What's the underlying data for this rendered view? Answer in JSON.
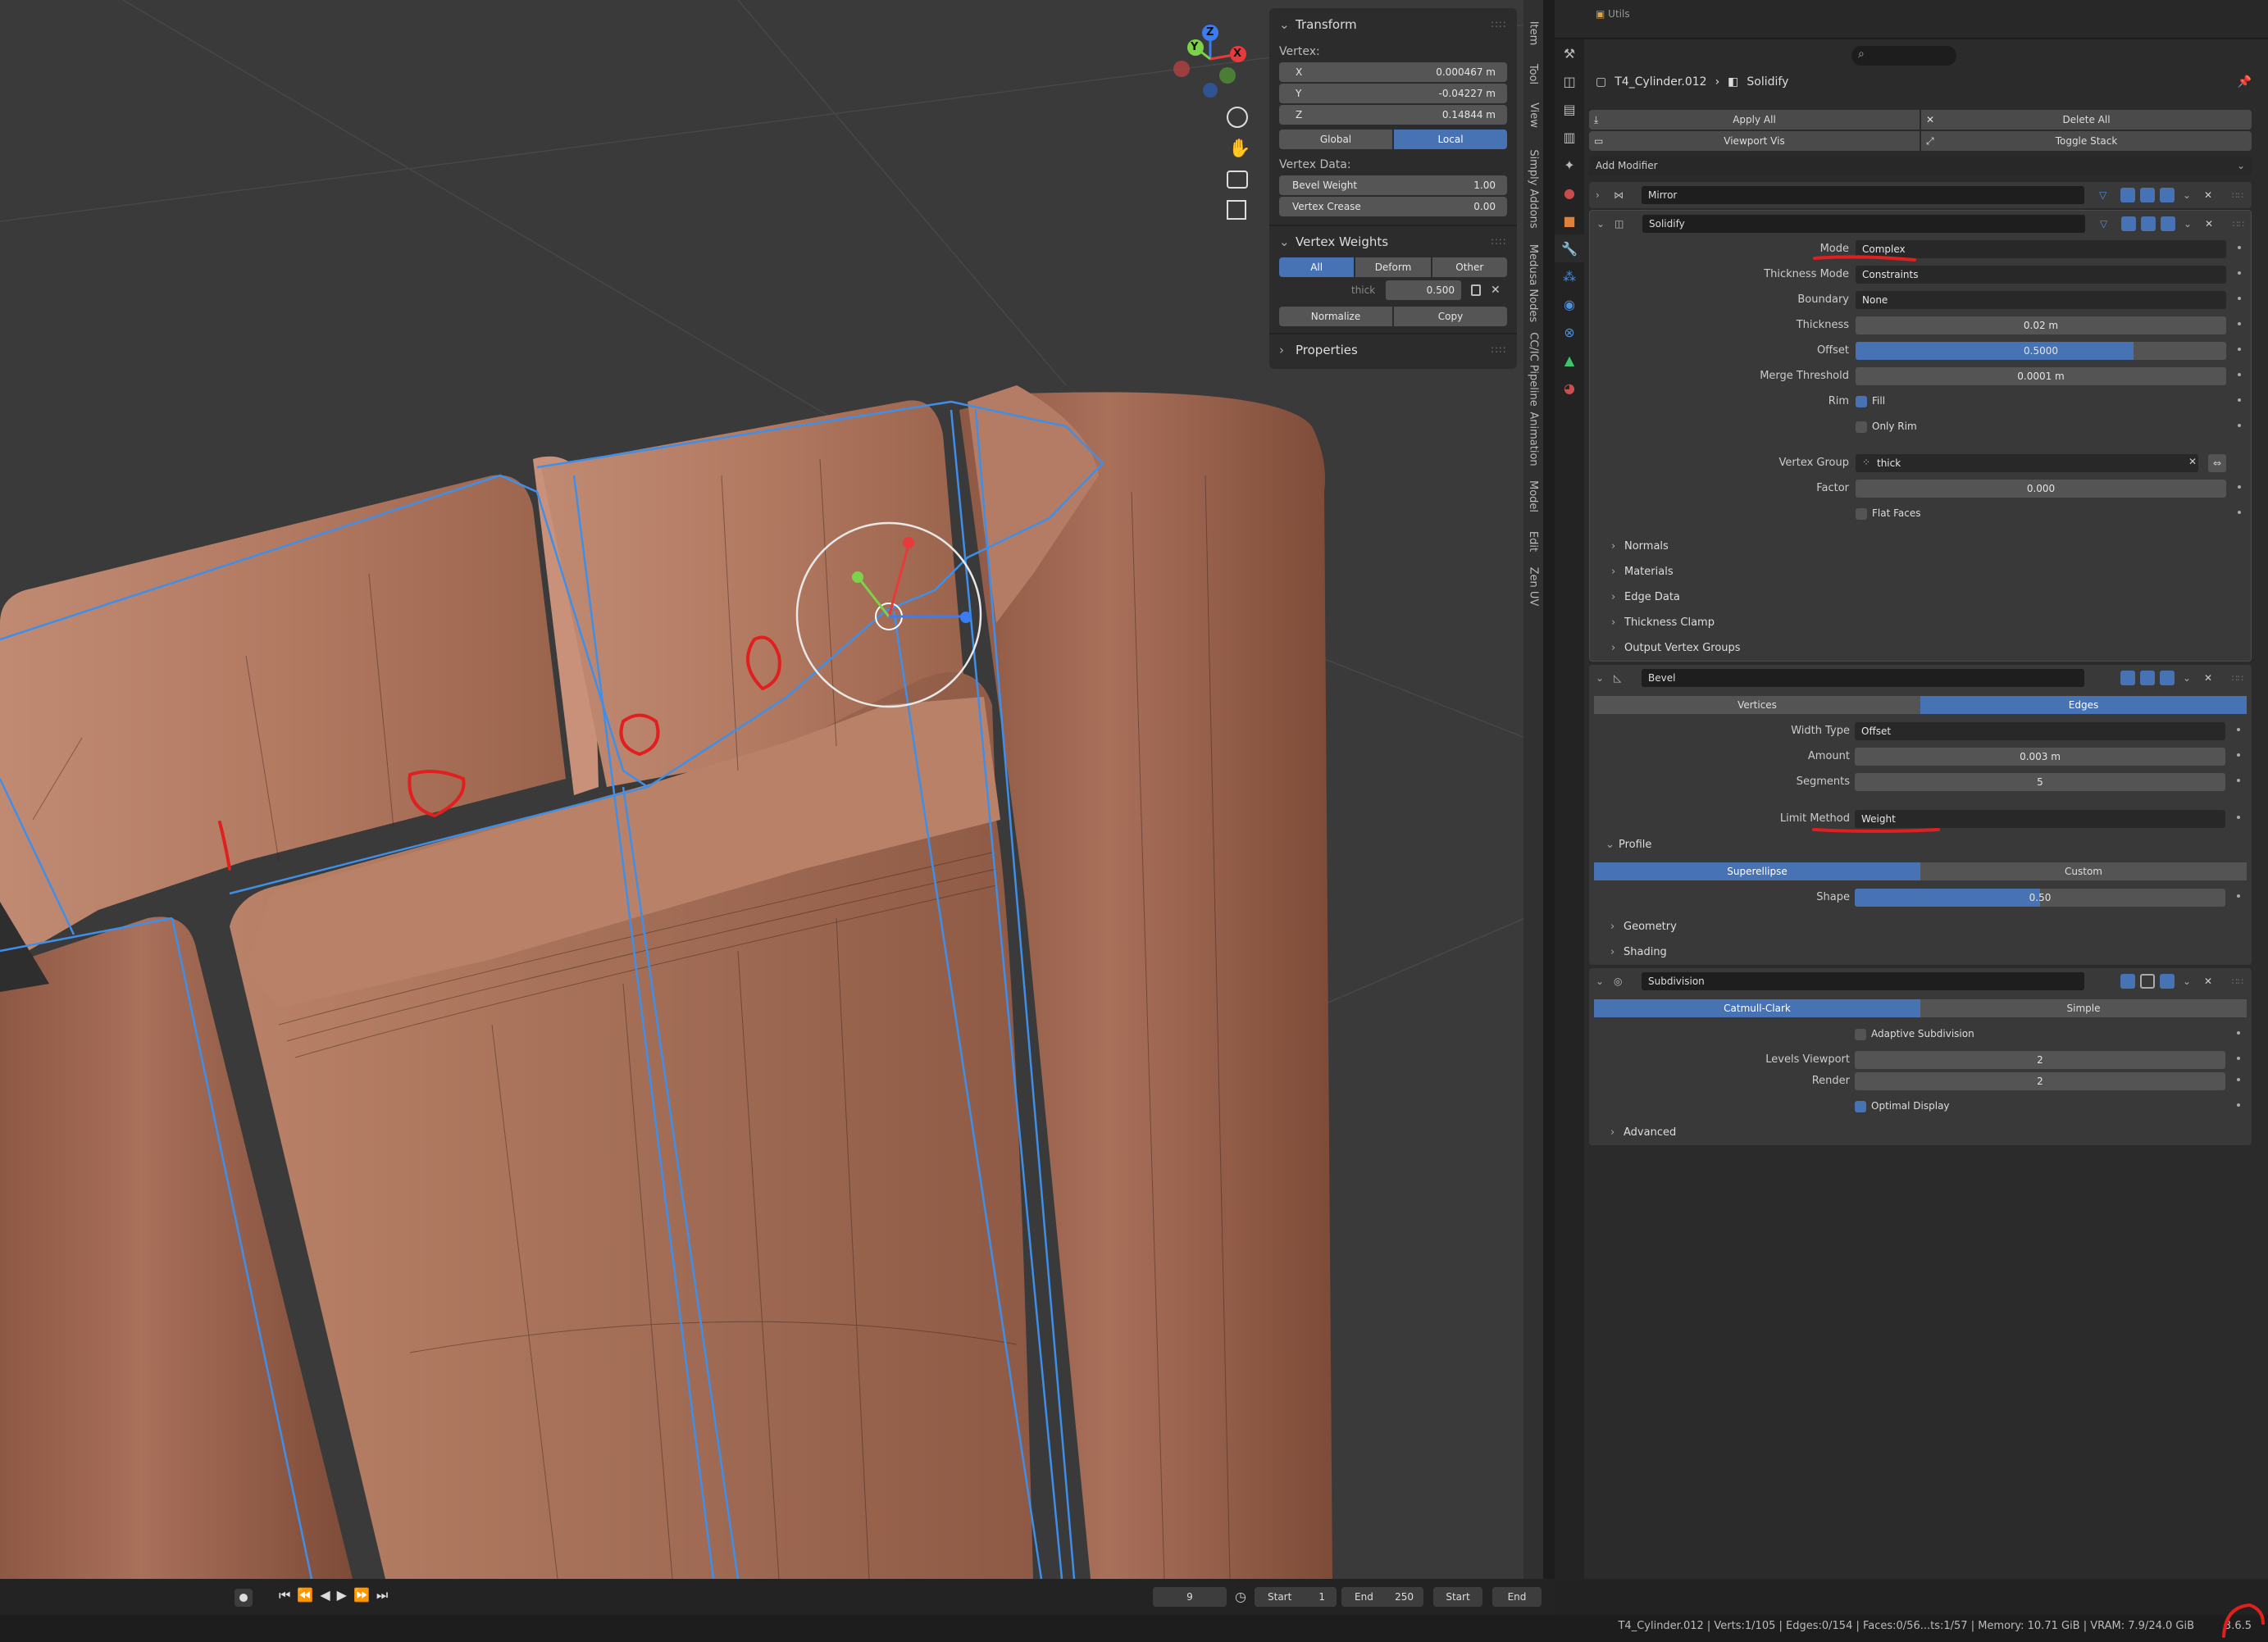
{
  "npanel": {
    "transform_title": "Transform",
    "vertex_label": "Vertex:",
    "x_label": "X",
    "x_value": "0.000467 m",
    "y_label": "Y",
    "y_value": "-0.04227 m",
    "z_label": "Z",
    "z_value": "0.14844 m",
    "global_label": "Global",
    "local_label": "Local",
    "vertex_data_label": "Vertex Data:",
    "bevel_weight_label": "Bevel Weight",
    "bevel_weight_value": "1.00",
    "vertex_crease_label": "Vertex Crease",
    "vertex_crease_value": "0.00",
    "vertex_weights_title": "Vertex Weights",
    "all_label": "All",
    "deform_label": "Deform",
    "other_label": "Other",
    "group_name": "thick",
    "group_weight": "0.500",
    "normalize_label": "Normalize",
    "copy_label": "Copy",
    "properties_title": "Properties"
  },
  "sidebar_tabs": [
    "Item",
    "Tool",
    "View",
    "Simply Addons",
    "Medusa Nodes",
    "CC/IC Pipeline",
    "Animation",
    "Model",
    "Edit",
    "Zen UV"
  ],
  "outliner": {
    "item": "Utils"
  },
  "properties": {
    "object_name": "T4_Cylinder.012",
    "modifier_name": "Solidify",
    "apply_all": "Apply All",
    "delete_all": "Delete All",
    "viewport_vis": "Viewport Vis",
    "toggle_stack": "Toggle Stack",
    "add_modifier": "Add Modifier",
    "mirror": {
      "name": "Mirror"
    },
    "solidify": {
      "name": "Solidify",
      "mode_label": "Mode",
      "mode_value": "Complex",
      "thickness_mode_label": "Thickness Mode",
      "thickness_mode_value": "Constraints",
      "boundary_label": "Boundary",
      "boundary_value": "None",
      "thickness_label": "Thickness",
      "thickness_value": "0.02 m",
      "offset_label": "Offset",
      "offset_value": "0.5000",
      "offset_fraction": 0.75,
      "merge_label": "Merge Threshold",
      "merge_value": "0.0001 m",
      "rim_label": "Rim",
      "fill_label": "Fill",
      "only_rim_label": "Only Rim",
      "vgroup_label": "Vertex Group",
      "vgroup_value": "thick",
      "factor_label": "Factor",
      "factor_value": "0.000",
      "flat_faces_label": "Flat Faces",
      "panels": [
        "Normals",
        "Materials",
        "Edge Data",
        "Thickness Clamp",
        "Output Vertex Groups"
      ]
    },
    "bevel": {
      "name": "Bevel",
      "vertices_label": "Vertices",
      "edges_label": "Edges",
      "width_type_label": "Width Type",
      "width_type_value": "Offset",
      "amount_label": "Amount",
      "amount_value": "0.003 m",
      "segments_label": "Segments",
      "segments_value": "5",
      "limit_label": "Limit Method",
      "limit_value": "Weight",
      "profile_label": "Profile",
      "superellipse_label": "Superellipse",
      "custom_label": "Custom",
      "shape_label": "Shape",
      "shape_value": "0.50",
      "shape_fraction": 0.5,
      "panels": [
        "Geometry",
        "Shading"
      ]
    },
    "subdivision": {
      "name": "Subdivision",
      "catmull_label": "Catmull-Clark",
      "simple_label": "Simple",
      "adaptive_label": "Adaptive Subdivision",
      "levels_label": "Levels Viewport",
      "levels_value": "2",
      "render_label": "Render",
      "render_value": "2",
      "optimal_label": "Optimal Display",
      "advanced_label": "Advanced"
    }
  },
  "timeline": {
    "frame": "9",
    "start_label": "Start",
    "start_value": "1",
    "end_label": "End",
    "end_value": "250",
    "start_btn": "Start",
    "end_btn": "End"
  },
  "status": {
    "text": "T4_Cylinder.012 | Verts:1/105 | Edges:0/154 | Faces:0/56...ts:1/57 | Memory: 10.71 GiB | VRAM: 7.9/24.0 GiB",
    "version": "3.6.5"
  },
  "gizmo": {
    "x": "X",
    "y": "Y",
    "z": "Z"
  },
  "colors": {
    "accent": "#4772b3",
    "annotation": "#e01f1f",
    "mesh": "#a06a55"
  }
}
